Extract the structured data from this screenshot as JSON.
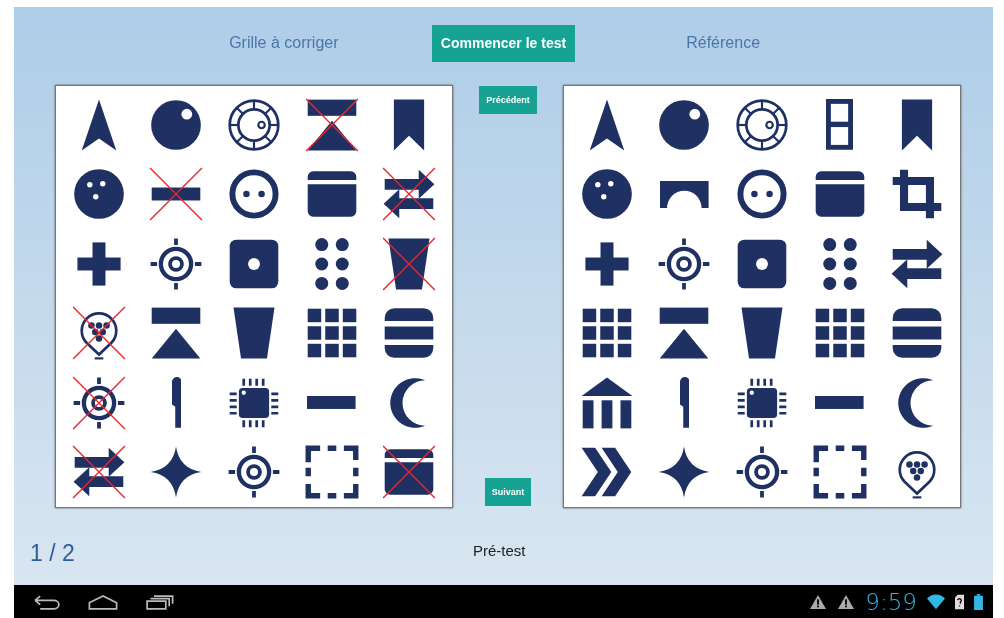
{
  "header": {
    "left_title": "Grille à corriger",
    "start_button": "Commencer le test",
    "right_title": "Référence"
  },
  "previous_button": "Précédent",
  "next_button": "Suivant",
  "grids": [
    {
      "cells": [
        {
          "kind": "arrow",
          "crossed": false
        },
        {
          "kind": "ball",
          "crossed": false
        },
        {
          "kind": "dial",
          "crossed": false
        },
        {
          "kind": "eject",
          "crossed": true
        },
        {
          "kind": "bookmark",
          "crossed": false
        },
        {
          "kind": "bowling",
          "crossed": false
        },
        {
          "kind": "bar",
          "crossed": true
        },
        {
          "kind": "socket",
          "crossed": false
        },
        {
          "kind": "card",
          "crossed": false
        },
        {
          "kind": "swap",
          "crossed": true
        },
        {
          "kind": "plus",
          "crossed": false
        },
        {
          "kind": "target",
          "crossed": false
        },
        {
          "kind": "die",
          "crossed": false
        },
        {
          "kind": "dots",
          "crossed": false
        },
        {
          "kind": "cup",
          "crossed": true
        },
        {
          "kind": "pin",
          "crossed": true
        },
        {
          "kind": "eject",
          "crossed": false
        },
        {
          "kind": "cup",
          "crossed": false
        },
        {
          "kind": "grid",
          "crossed": false
        },
        {
          "kind": "burger",
          "crossed": false
        },
        {
          "kind": "target",
          "crossed": true
        },
        {
          "kind": "knife",
          "crossed": false
        },
        {
          "kind": "chip",
          "crossed": false
        },
        {
          "kind": "bar",
          "crossed": false
        },
        {
          "kind": "moon",
          "crossed": false
        },
        {
          "kind": "swap",
          "crossed": true
        },
        {
          "kind": "star",
          "crossed": false
        },
        {
          "kind": "target",
          "crossed": false
        },
        {
          "kind": "dashed",
          "crossed": false
        },
        {
          "kind": "card",
          "crossed": true
        }
      ]
    },
    {
      "cells": [
        {
          "kind": "arrow",
          "crossed": false
        },
        {
          "kind": "ball",
          "crossed": false
        },
        {
          "kind": "dial",
          "crossed": false
        },
        {
          "kind": "twin",
          "crossed": false
        },
        {
          "kind": "bookmark",
          "crossed": false
        },
        {
          "kind": "bowling",
          "crossed": false
        },
        {
          "kind": "arch",
          "crossed": false
        },
        {
          "kind": "socket",
          "crossed": false
        },
        {
          "kind": "card",
          "crossed": false
        },
        {
          "kind": "crop",
          "crossed": false
        },
        {
          "kind": "plus",
          "crossed": false
        },
        {
          "kind": "target",
          "crossed": false
        },
        {
          "kind": "die",
          "crossed": false
        },
        {
          "kind": "dots",
          "crossed": false
        },
        {
          "kind": "swap",
          "crossed": false
        },
        {
          "kind": "grid",
          "crossed": false
        },
        {
          "kind": "eject",
          "crossed": false
        },
        {
          "kind": "cup",
          "crossed": false
        },
        {
          "kind": "grid",
          "crossed": false
        },
        {
          "kind": "burger",
          "crossed": false
        },
        {
          "kind": "bank",
          "crossed": false
        },
        {
          "kind": "knife",
          "crossed": false
        },
        {
          "kind": "chip",
          "crossed": false
        },
        {
          "kind": "bar",
          "crossed": false
        },
        {
          "kind": "moon",
          "crossed": false
        },
        {
          "kind": "chevrons",
          "crossed": false
        },
        {
          "kind": "star",
          "crossed": false
        },
        {
          "kind": "target",
          "crossed": false
        },
        {
          "kind": "dashed",
          "crossed": false
        },
        {
          "kind": "pin",
          "crossed": false
        }
      ]
    }
  ],
  "page_counter": "1 / 2",
  "phase": "Pré-test",
  "status_bar": {
    "time": "9:59"
  }
}
